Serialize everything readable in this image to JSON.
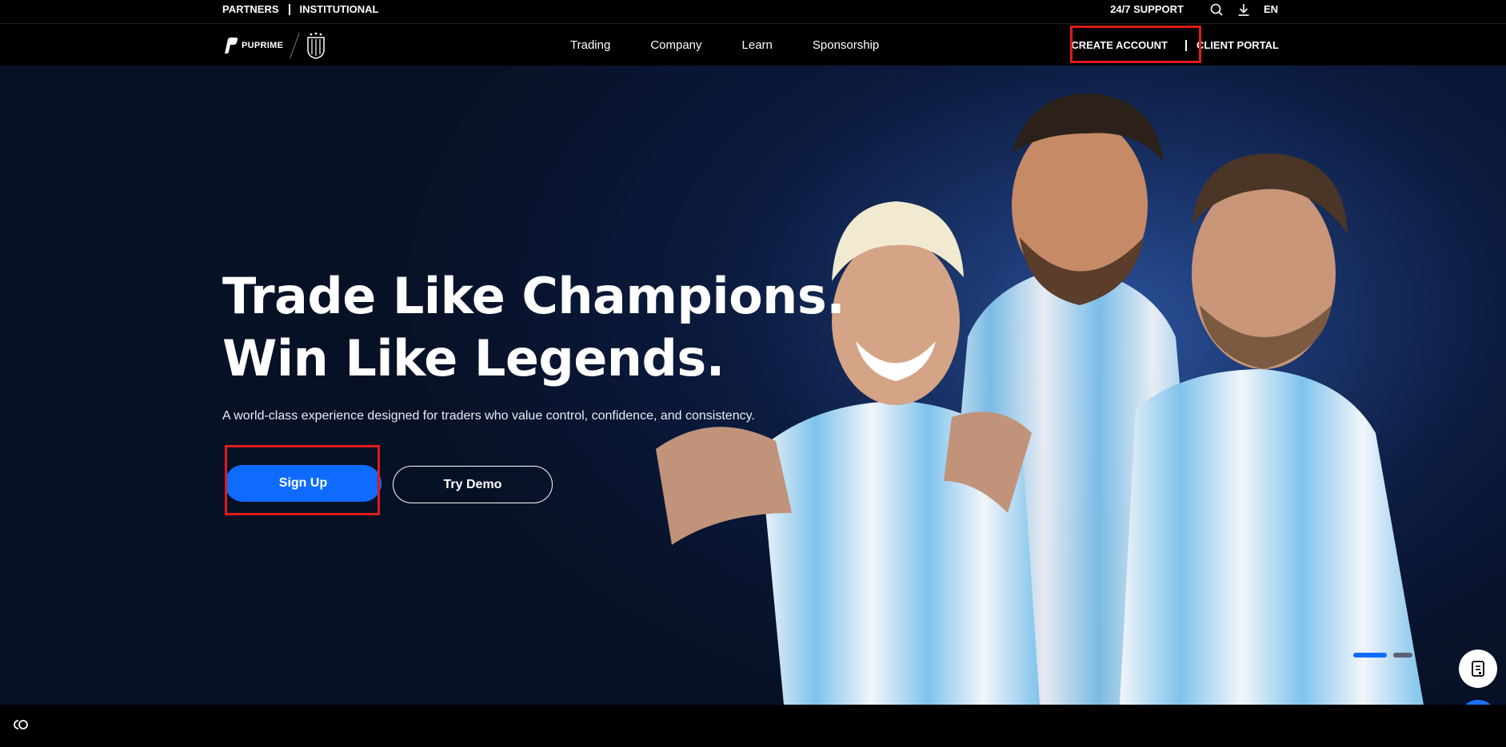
{
  "topbar": {
    "partners": "PARTNERS",
    "institutional": "INSTITUTIONAL",
    "support": "24/7 SUPPORT",
    "language": "EN"
  },
  "nav": {
    "brand": "PUPRIME",
    "menu": [
      "Trading",
      "Company",
      "Learn",
      "Sponsorship"
    ],
    "create_account": "CREATE ACCOUNT",
    "client_portal": "CLIENT PORTAL"
  },
  "hero": {
    "title_line1": "Trade Like Champions.",
    "title_line2": "Win Like Legends.",
    "subtitle": "A world-class experience designed for traders who value control, confidence, and consistency.",
    "signup_label": "Sign Up",
    "demo_label": "Try Demo",
    "slide_dots": [
      true,
      false
    ]
  },
  "colors": {
    "accent": "#0f6bff",
    "annotation": "#e01b1b",
    "background": "#000000"
  },
  "icons": [
    "search-icon",
    "download-icon",
    "document-icon",
    "chat-icon",
    "cookie-icon"
  ]
}
